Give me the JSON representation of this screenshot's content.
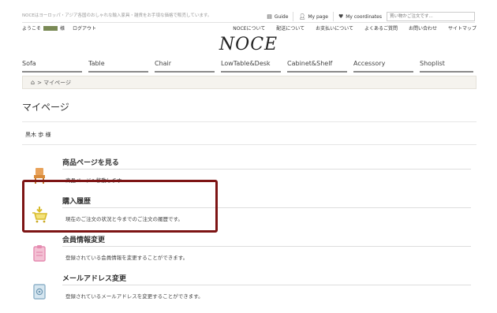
{
  "topbar": {
    "tagline": "NOCEはヨーロッパ・アジア各国のおしゃれな輸入家具・雑貨をお手頃な価格で販売しています。",
    "links": [
      {
        "icon": "guide-book-icon",
        "label": "Guide"
      },
      {
        "icon": "user-icon",
        "label": "My page"
      },
      {
        "icon": "heart-icon",
        "label": "My coordinates"
      }
    ],
    "search_placeholder": "買い物かご注文です..."
  },
  "userbar": {
    "welcome_prefix": "ようこそ",
    "welcome_suffix": "様",
    "user_color": "#7a8a55",
    "logout": "ログアウト",
    "links": [
      "NOCEについて",
      "配送について",
      "お支払いについて",
      "よくあるご質問",
      "お問い合わせ",
      "サイトマップ"
    ]
  },
  "logo": "NOCE",
  "categories": [
    "Sofa",
    "Table",
    "Chair",
    "LowTable&Desk",
    "Cabinet&Shelf",
    "Accessory",
    "Shoplist"
  ],
  "breadcrumb": {
    "current": "マイページ"
  },
  "page_title": "マイページ",
  "user_name": "黒木 歩 様",
  "menu": [
    {
      "title": "商品ページを見る",
      "desc": "商品ページへ移動します",
      "icon": "chair-icon",
      "color": "#e8a25a"
    },
    {
      "title": "購入履歴",
      "desc": "現在のご注文の状況と今までのご注文の履歴です。",
      "icon": "shopping-cart-icon",
      "color": "#d8bb2a"
    },
    {
      "title": "会員情報変更",
      "desc": "登録されている会員情報を変更することができます。",
      "icon": "member-card-icon",
      "color": "#e58bb0"
    },
    {
      "title": "メールアドレス変更",
      "desc": "登録されているメールアドレスを変更することができます。",
      "icon": "mail-book-icon",
      "color": "#8fb2c9"
    }
  ],
  "highlight_color": "#7d1414"
}
